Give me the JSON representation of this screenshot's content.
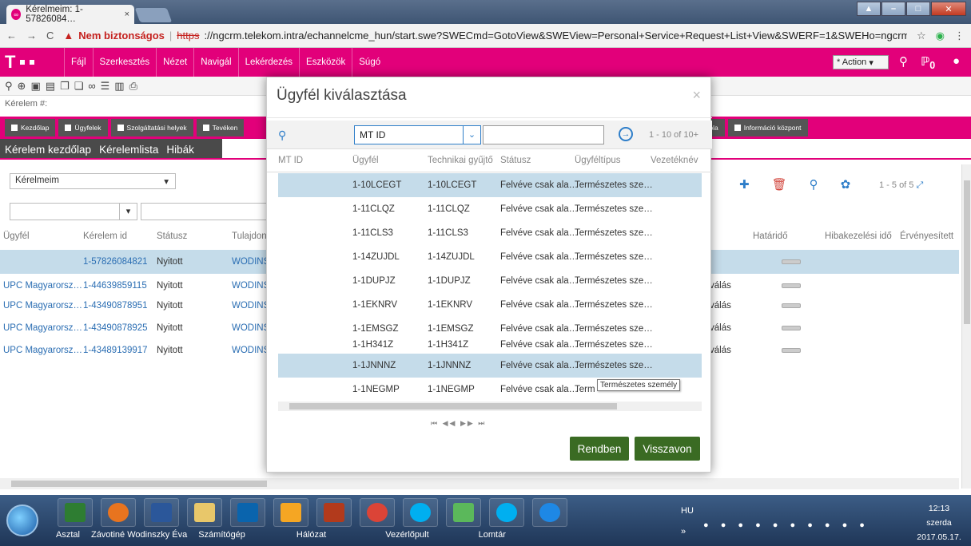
{
  "browser": {
    "tab_title": "Kérelmeim: 1-57826084…",
    "tab_close": "×",
    "warning": "Nem biztonságos",
    "https": "https",
    "url": "://ngcrm.telekom.intra/echannelcme_hun/start.swe?SWECmd=GotoView&SWEView=Personal+Service+Request+List+View&SWERF=1&SWEHo=ngcrm.telekom."
  },
  "app": {
    "logo": "T",
    "menus": [
      "Fájl",
      "Szerkesztés",
      "Nézet",
      "Navigál",
      "Lekérdezés",
      "Eszközök",
      "Súgó"
    ],
    "action_label": "* Action",
    "notif_count": "0",
    "accent": "#e2007a"
  },
  "record_label": "Kérelem #:",
  "navtabs": [
    "Kezdőlap",
    "Ügyfelek",
    "Szolgáltatási helyek",
    "Tevéken",
    "státusztábla",
    "Információ központ"
  ],
  "subnav": [
    "Kérelem kezdőlap",
    "Kérelemlista",
    "Hibák"
  ],
  "list": {
    "query_select": "Kérelmeim",
    "pager": "1 - 5 of 5",
    "columns": [
      "Ügyfél",
      "Kérelem id",
      "Státusz",
      "Tulajdon",
      "Határidő",
      "Hibakezelési idő",
      "Érvényesített"
    ],
    "rows": [
      {
        "customer": "",
        "id": "1-57826084821",
        "status": "Nyitott",
        "owner": "WODINS",
        "extra": ""
      },
      {
        "customer": "UPC Magyarorsz…",
        "id": "1-44639859115",
        "status": "Nyitott",
        "owner": "WODINS",
        "extra": "válás"
      },
      {
        "customer": "UPC Magyarorsz…",
        "id": "1-43490878951",
        "status": "Nyitott",
        "owner": "WODINS",
        "extra": "válás"
      },
      {
        "customer": "UPC Magyarorsz…",
        "id": "1-43490878925",
        "status": "Nyitott",
        "owner": "WODINS",
        "extra": "válás"
      },
      {
        "customer": "UPC Magyarorsz…",
        "id": "1-43489139917",
        "status": "Nyitott",
        "owner": "WODINS",
        "extra": "válás"
      }
    ]
  },
  "modal": {
    "title": "Ügyfél kiválasztása",
    "close": "×",
    "field": "MT ID",
    "count": "1 - 10 of 10+",
    "columns": [
      "MT ID",
      "Ügyfél",
      "Technikai gyűjtő",
      "Státusz",
      "Ügyféltípus",
      "Vezetéknév"
    ],
    "rows": [
      {
        "mtid": "",
        "ugyfel": "1-10LCEGT",
        "tech": "1-10LCEGT",
        "status": "Felvéve csak ala…",
        "type": "Természetes sze…"
      },
      {
        "mtid": "",
        "ugyfel": "1-11CLQZ",
        "tech": "1-11CLQZ",
        "status": "Felvéve csak ala…",
        "type": "Természetes sze…"
      },
      {
        "mtid": "",
        "ugyfel": "1-11CLS3",
        "tech": "1-11CLS3",
        "status": "Felvéve csak ala…",
        "type": "Természetes sze…"
      },
      {
        "mtid": "",
        "ugyfel": "1-14ZUJDL",
        "tech": "1-14ZUJDL",
        "status": "Felvéve csak ala…",
        "type": "Természetes sze…"
      },
      {
        "mtid": "",
        "ugyfel": "1-1DUPJZ",
        "tech": "1-1DUPJZ",
        "status": "Felvéve csak ala…",
        "type": "Természetes sze…"
      },
      {
        "mtid": "",
        "ugyfel": "1-1EKNRV",
        "tech": "1-1EKNRV",
        "status": "Felvéve csak ala…",
        "type": "Természetes sze…"
      },
      {
        "mtid": "",
        "ugyfel": "1-1EMSGZ",
        "tech": "1-1EMSGZ",
        "status": "Felvéve csak ala…",
        "type": "Természetes sze…"
      },
      {
        "mtid": "",
        "ugyfel": "1-1H341Z",
        "tech": "1-1H341Z",
        "status": "Felvéve csak ala…",
        "type": "Természetes sze…"
      },
      {
        "mtid": "",
        "ugyfel": "1-1JNNNZ",
        "tech": "1-1JNNNZ",
        "status": "Felvéve csak ala…",
        "type": "Természetes sze…"
      },
      {
        "mtid": "",
        "ugyfel": "1-1NEGMP",
        "tech": "1-1NEGMP",
        "status": "Felvéve csak ala…",
        "type": "Term"
      }
    ],
    "tooltip": "Természetes személy",
    "pager": "⏮ ◀◀ ▶▶ ⏭",
    "ok": "Rendben",
    "cancel": "Visszavon"
  },
  "taskbar": {
    "quick": [
      "Asztal",
      "Závotiné Wodinszky Éva",
      "Számítógép",
      "Hálózat",
      "Vezérlőpult",
      "Lomtár"
    ],
    "lang": "HU",
    "time": "12:13",
    "day": "szerda",
    "date": "2017.05.17."
  }
}
